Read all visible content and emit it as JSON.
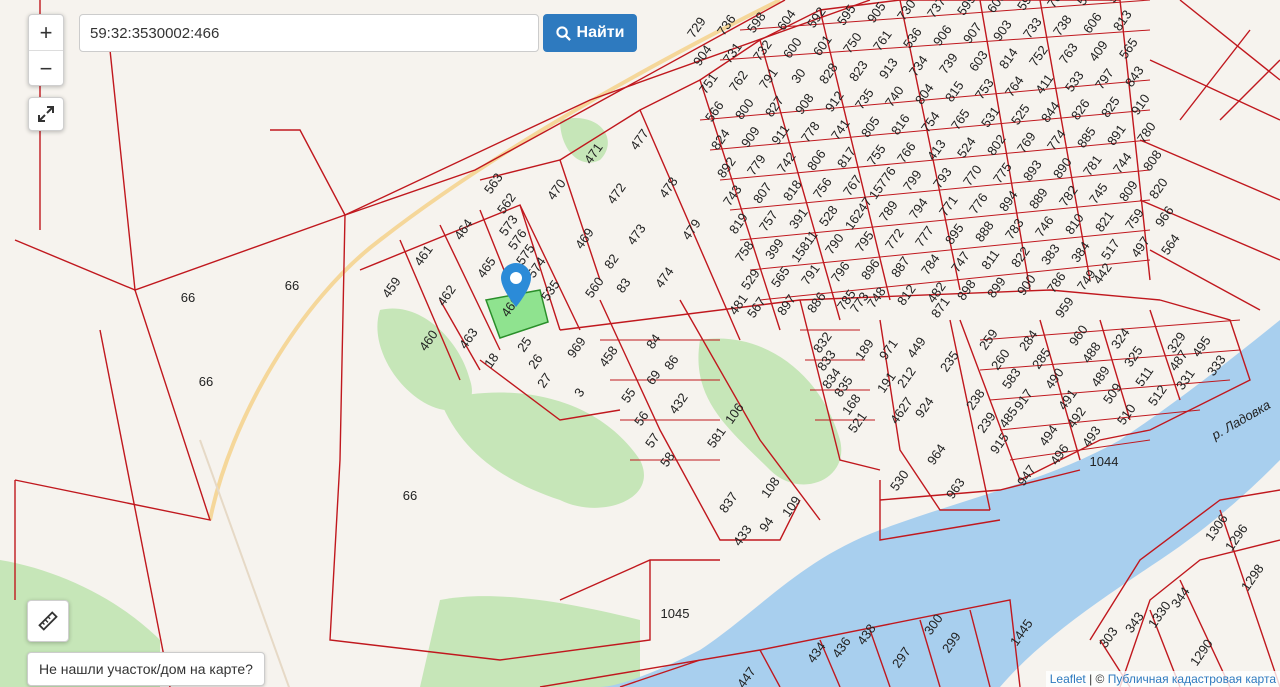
{
  "search": {
    "value": "59:32:3530002:466",
    "button_label": "Найти"
  },
  "controls": {
    "zoom_in": "+",
    "zoom_out": "−"
  },
  "hint": {
    "label": "Не нашли участок/дом на карте?"
  },
  "attribution": {
    "leaflet": "Leaflet",
    "separator": " | © ",
    "source": "Публичная кадастровая карта"
  },
  "map": {
    "river_label": "р. Ладовка",
    "selected_plot": "466",
    "plot_labels": [
      "729",
      "736",
      "598",
      "604",
      "592",
      "595",
      "905",
      "730",
      "737",
      "599",
      "605",
      "594",
      "760",
      "537",
      "902",
      "904",
      "731",
      "732",
      "600",
      "601",
      "750",
      "761",
      "536",
      "906",
      "907",
      "903",
      "733",
      "738",
      "606",
      "813",
      "751",
      "762",
      "791",
      "30",
      "828",
      "823",
      "913",
      "734",
      "739",
      "603",
      "814",
      "752",
      "763",
      "409",
      "565",
      "566",
      "800",
      "827",
      "908",
      "912",
      "735",
      "740",
      "804",
      "815",
      "753",
      "764",
      "411",
      "533",
      "797",
      "843",
      "824",
      "909",
      "911",
      "778",
      "741",
      "805",
      "816",
      "754",
      "765",
      "531",
      "525",
      "477",
      "844",
      "826",
      "825",
      "910",
      "892",
      "779",
      "742",
      "806",
      "817",
      "755",
      "766",
      "413",
      "524",
      "471",
      "802",
      "769",
      "774",
      "885",
      "891",
      "780",
      "743",
      "807",
      "818",
      "756",
      "767",
      "15776",
      "470",
      "478",
      "799",
      "793",
      "770",
      "775",
      "893",
      "890",
      "781",
      "744",
      "808",
      "819",
      "757",
      "391",
      "528",
      "16247",
      "563",
      "562",
      "472",
      "789",
      "794",
      "771",
      "776",
      "894",
      "889",
      "782",
      "745",
      "809",
      "820",
      "758",
      "399",
      "15811",
      "464",
      "573",
      "576",
      "469",
      "473",
      "479",
      "790",
      "795",
      "772",
      "777",
      "895",
      "888",
      "783",
      "746",
      "810",
      "821",
      "759",
      "966",
      "529",
      "461",
      "465",
      "575",
      "565",
      "791",
      "796",
      "896",
      "887",
      "784",
      "747",
      "811",
      "822",
      "383",
      "384",
      "517",
      "497",
      "574",
      "564",
      "567",
      "897",
      "886",
      "785",
      "748",
      "812",
      "442",
      "482",
      "459",
      "462",
      "535",
      "560",
      "83",
      "474",
      "898",
      "899",
      "900",
      "786",
      "749",
      "871",
      "773",
      "959",
      "466",
      "82",
      "481",
      "25",
      "463",
      "460",
      "18",
      "26",
      "969",
      "66",
      "84",
      "86",
      "832",
      "189",
      "971",
      "449",
      "235",
      "259",
      "284",
      "960",
      "324",
      "329",
      "495",
      "833",
      "834",
      "835",
      "168",
      "521",
      "27",
      "458",
      "69",
      "191",
      "212",
      "260",
      "583",
      "285",
      "488",
      "325",
      "487",
      "333",
      "3",
      "55",
      "432",
      "4627",
      "924",
      "238",
      "917",
      "490",
      "489",
      "511",
      "331",
      "56",
      "106",
      "239",
      "485",
      "491",
      "509",
      "512",
      "57",
      "581",
      "964",
      "915",
      "494",
      "492",
      "510",
      "58",
      "963",
      "496",
      "493",
      "1044",
      "108",
      "530",
      "947",
      "837",
      "109",
      "94",
      "433",
      "1045",
      "1306",
      "1296",
      "1298",
      "344",
      "1330",
      "343",
      "303",
      "1290",
      "1445",
      "438",
      "300",
      "447",
      "434",
      "436",
      "297",
      "299"
    ]
  }
}
